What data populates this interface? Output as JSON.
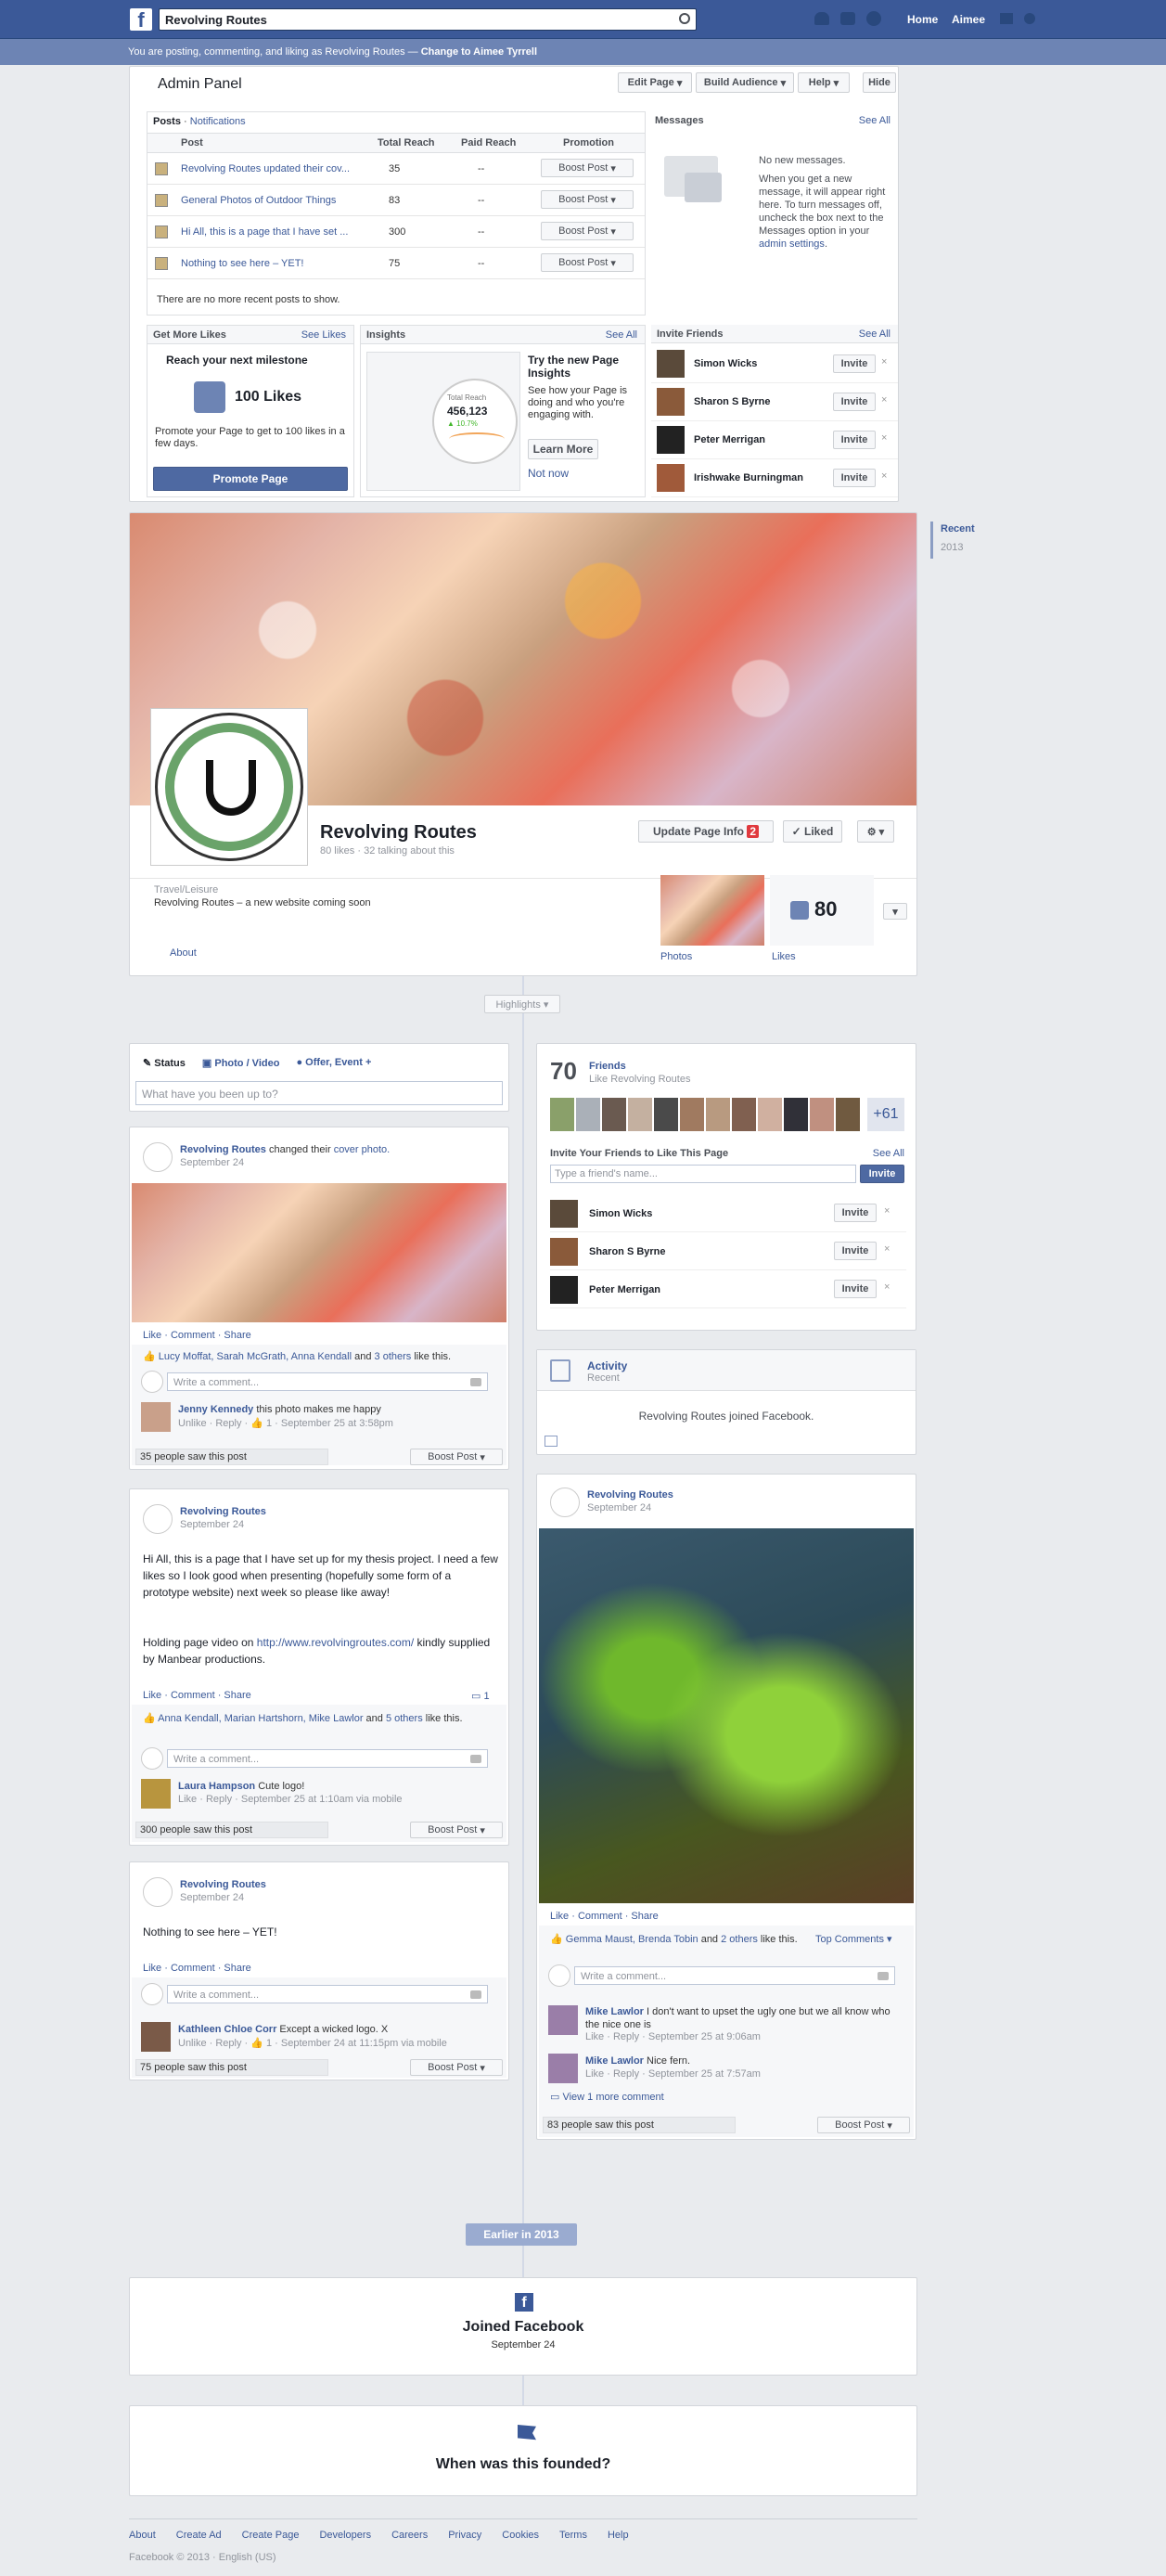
{
  "topbar": {
    "search_value": "Revolving Routes",
    "home": "Home",
    "user": "Aimee"
  },
  "adminbar": {
    "text": "You are posting, commenting, and liking as Revolving Routes — ",
    "switch": "Change to Aimee Tyrrell"
  },
  "admin": {
    "title": "Admin Panel",
    "edit_page": "Edit Page",
    "build_audience": "Build Audience",
    "help": "Help",
    "hide": "Hide",
    "posts_tab": "Posts",
    "notifications_tab": "Notifications",
    "col_post": "Post",
    "col_reach": "Total Reach",
    "col_paid": "Paid Reach",
    "col_promo": "Promotion",
    "posts": [
      {
        "title": "Revolving Routes updated their cov...",
        "reach": "35",
        "paid": "--",
        "promo": "Boost Post"
      },
      {
        "title": "General Photos of Outdoor Things",
        "reach": "83",
        "paid": "--",
        "promo": "Boost Post"
      },
      {
        "title": "Hi All, this is a page that I have set ...",
        "reach": "300",
        "paid": "--",
        "promo": "Boost Post"
      },
      {
        "title": "Nothing to see here – YET!",
        "reach": "75",
        "paid": "--",
        "promo": "Boost Post"
      }
    ],
    "no_more": "There are no more recent posts to show.",
    "messages_title": "Messages",
    "see_all": "See All",
    "no_messages": "No new messages.",
    "messages_body": "When you get a new message, it will appear right here. To turn messages off, uncheck the box next to the Messages option in your ",
    "admin_settings": "admin settings",
    "likes_title": "Get More Likes",
    "see_likes": "See Likes",
    "milestone": "Reach your next milestone",
    "likes_goal": "100 Likes",
    "promote_text": "Promote your Page to get to 100 likes in a few days.",
    "promote_btn": "Promote Page",
    "insights_title": "Insights",
    "insights_see_all": "See All",
    "insights_head": "Try the new Page Insights",
    "insights_body": "See how your Page is doing and who you're engaging with.",
    "learn_more": "Learn More",
    "not_now": "Not now",
    "insights_num": "456,123",
    "insights_pct": "▲ 10.7%",
    "insights_lbl": "Total Reach",
    "invite_title": "Invite Friends",
    "invite_see_all": "See All",
    "invite_btn": "Invite",
    "invitees": [
      "Simon Wicks",
      "Sharon S Byrne",
      "Peter Merrigan",
      "Irishwake Burningman"
    ]
  },
  "nav": {
    "recent": "Recent",
    "y2013": "2013"
  },
  "page": {
    "name": "Revolving Routes",
    "stats": "80 likes · 32 talking about this",
    "update_info": "Update Page Info",
    "badge": "2",
    "liked": "✓ Liked",
    "category": "Travel/Leisure",
    "desc": "Revolving Routes – a new website coming soon",
    "about": "About",
    "photos": "Photos",
    "likes_label": "Likes",
    "likes_count": "80",
    "highlights": "Highlights ▾"
  },
  "composer": {
    "status": "Status",
    "photo": "Photo / Video",
    "offer": "Offer, Event +",
    "placeholder": "What have you been up to?"
  },
  "post1": {
    "author": "Revolving Routes",
    "action": " changed their ",
    "link": "cover photo.",
    "date": "September 24",
    "actions": "Like · Comment · Share",
    "likers": "Lucy Moffat, Sarah McGrath, Anna Kendall",
    "likers_rest": " and ",
    "others": "3 others",
    "likes_this": " like this.",
    "write": "Write a comment...",
    "c_author": "Jenny Kennedy",
    "c_text": " this photo makes me happy",
    "c_meta": "Unlike · Reply · 👍 1 · September 25 at 3:58pm",
    "seen": "35 people saw this post",
    "boost": "Boost Post"
  },
  "post2": {
    "author": "Revolving Routes",
    "date": "September 24",
    "p1": "Hi All, this is a page that I have set up for my thesis project. I need a few likes so I look good when presenting (hopefully some form of a prototype website) next week so please like away!",
    "p2a": "Holding page video on ",
    "url": "http://www.revolvingroutes.com/",
    "p2b": " kindly supplied by Manbear productions.",
    "actions": "Like · Comment · Share",
    "comments_count": "1",
    "likers": "Anna Kendall, Marian Hartshorn, Mike Lawlor",
    "likers_rest": " and ",
    "others": "5 others",
    "likes_this": " like this.",
    "write": "Write a comment...",
    "c_author": "Laura Hampson",
    "c_text": " Cute logo!",
    "c_meta": "Like · Reply · September 25 at 1:10am via mobile",
    "seen": "300 people saw this post",
    "boost": "Boost Post"
  },
  "post3": {
    "author": "Revolving Routes",
    "date": "September 24",
    "text": "Nothing to see here – YET!",
    "actions": "Like · Comment · Share",
    "write": "Write a comment...",
    "c_author": "Kathleen Chloe Corr",
    "c_text": " Except a wicked logo. X",
    "c_meta": "Unlike · Reply · 👍 1 · September 24 at 11:15pm via mobile",
    "seen": "75 people saw this post",
    "boost": "Boost Post"
  },
  "friends": {
    "count": "70",
    "title": "Friends",
    "sub": "Like Revolving Routes",
    "more": "+61",
    "invite_title": "Invite Your Friends to Like This Page",
    "see_all": "See All",
    "placeholder": "Type a friend's name...",
    "invite": "Invite",
    "list": [
      "Simon Wicks",
      "Sharon S Byrne",
      "Peter Merrigan"
    ]
  },
  "activity": {
    "title": "Activity",
    "sub": "Recent",
    "text": "Revolving Routes joined Facebook."
  },
  "post4": {
    "author": "Revolving Routes",
    "date": "September 24",
    "actions": "Like · Comment · Share",
    "likers": "Gemma Maust, Brenda Tobin",
    "likers_rest": " and ",
    "others": "2 others",
    "likes_this": " like this.",
    "top": "Top Comments ▾",
    "write": "Write a comment...",
    "c1_author": "Mike Lawlor",
    "c1_text": " I don't want to upset the ugly one but we all know who the nice one is",
    "c1_meta": "Like · Reply · September 25 at 9:06am",
    "c2_author": "Mike Lawlor",
    "c2_text": " Nice fern.",
    "c2_meta": "Like · Reply · September 25 at 7:57am",
    "more": "View 1 more comment",
    "seen": "83 people saw this post",
    "boost": "Boost Post"
  },
  "earlier": "Earlier in 2013",
  "joined": {
    "title": "Joined Facebook",
    "date": "September 24"
  },
  "founded": "When was this founded?",
  "footer": {
    "links": [
      "About",
      "Create Ad",
      "Create Page",
      "Developers",
      "Careers",
      "Privacy",
      "Cookies",
      "Terms",
      "Help"
    ],
    "copy": "Facebook © 2013 · English (US)"
  }
}
